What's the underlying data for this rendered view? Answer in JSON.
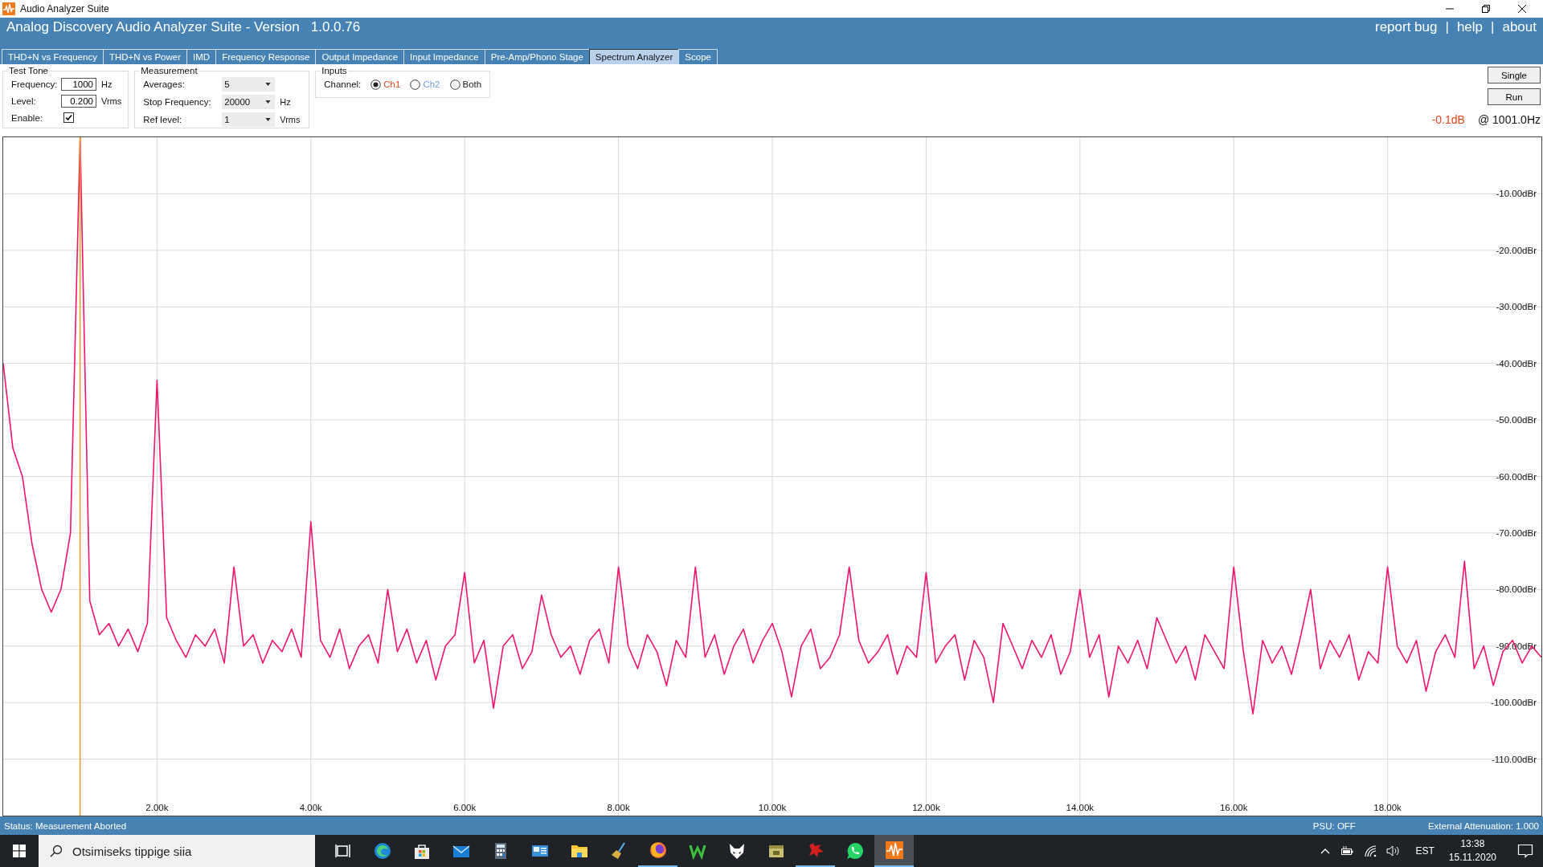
{
  "window": {
    "title": "Audio Analyzer Suite"
  },
  "header": {
    "title": "Analog Discovery Audio Analyzer Suite - Version",
    "version": "1.0.0.76",
    "links": [
      "report bug",
      "help",
      "about"
    ],
    "separator": "|"
  },
  "tabs": [
    {
      "label": "THD+N vs Frequency",
      "selected": false
    },
    {
      "label": "THD+N vs Power",
      "selected": false
    },
    {
      "label": "IMD",
      "selected": false
    },
    {
      "label": "Frequency Response",
      "selected": false
    },
    {
      "label": "Output Impedance",
      "selected": false
    },
    {
      "label": "Input Impedance",
      "selected": false
    },
    {
      "label": "Pre-Amp/Phono Stage",
      "selected": false
    },
    {
      "label": "Spectrum Analyzer",
      "selected": true
    },
    {
      "label": "Scope",
      "selected": false
    }
  ],
  "test_tone": {
    "title": "Test Tone",
    "fields": [
      {
        "label": "Frequency:",
        "value": "1000",
        "unit": "Hz"
      },
      {
        "label": "Level:",
        "value": "0.200",
        "unit": "Vrms"
      }
    ],
    "enable": {
      "label": "Enable:",
      "checked": true
    }
  },
  "measurement": {
    "title": "Measurement",
    "fields": [
      {
        "label": "Averages:",
        "value": "5"
      },
      {
        "label": "Stop Frequency:",
        "value": "20000",
        "unit": "Hz"
      },
      {
        "label": "Ref level:",
        "value": "1",
        "unit": "Vrms"
      }
    ]
  },
  "inputs": {
    "title": "Inputs",
    "channel_label": "Channel:",
    "options": [
      {
        "label": "Ch1",
        "selected": true,
        "color": "#e0441b"
      },
      {
        "label": "Ch2",
        "selected": false,
        "color": "#6b9be0"
      },
      {
        "label": "Both",
        "selected": false,
        "color": "#1a1a1a"
      }
    ]
  },
  "buttons": [
    "Single",
    "Run"
  ],
  "reading": {
    "level": "-0.1dB",
    "frequency": "@ 1001.0Hz"
  },
  "plot": {
    "chart_data": {
      "type": "line",
      "xlim": [
        0,
        20000
      ],
      "ylim": [
        -120,
        0
      ],
      "xticks": [
        {
          "value": 2000,
          "label": "2.00k"
        },
        {
          "value": 4000,
          "label": "4.00k"
        },
        {
          "value": 6000,
          "label": "6.00k"
        },
        {
          "value": 8000,
          "label": "8.00k"
        },
        {
          "value": 10000,
          "label": "10.00k"
        },
        {
          "value": 12000,
          "label": "12.00k"
        },
        {
          "value": 14000,
          "label": "14.00k"
        },
        {
          "value": 16000,
          "label": "16.00k"
        },
        {
          "value": 18000,
          "label": "18.00k"
        }
      ],
      "yticks": [
        {
          "value": -10,
          "label": "-10.00dBr"
        },
        {
          "value": -20,
          "label": "-20.00dBr"
        },
        {
          "value": -30,
          "label": "-30.00dBr"
        },
        {
          "value": -40,
          "label": "-40.00dBr"
        },
        {
          "value": -50,
          "label": "-50.00dBr"
        },
        {
          "value": -60,
          "label": "-60.00dBr"
        },
        {
          "value": -70,
          "label": "-70.00dBr"
        },
        {
          "value": -80,
          "label": "-80.00dBr"
        },
        {
          "value": -90,
          "label": "-90.00dBr"
        },
        {
          "value": -100,
          "label": "-100.00dBr"
        },
        {
          "value": -110,
          "label": "-110.00dBr"
        }
      ],
      "x": [
        0,
        125,
        250,
        375,
        500,
        625,
        750,
        875,
        1000,
        1125,
        1250,
        1375,
        1500,
        1625,
        1750,
        1875,
        2000,
        2125,
        2250,
        2375,
        2500,
        2625,
        2750,
        2875,
        3000,
        3125,
        3250,
        3375,
        3500,
        3625,
        3750,
        3875,
        4000,
        4125,
        4250,
        4375,
        4500,
        4625,
        4750,
        4875,
        5000,
        5125,
        5250,
        5375,
        5500,
        5625,
        5750,
        5875,
        6000,
        6125,
        6250,
        6375,
        6500,
        6625,
        6750,
        6875,
        7000,
        7125,
        7250,
        7375,
        7500,
        7625,
        7750,
        7875,
        8000,
        8125,
        8250,
        8375,
        8500,
        8625,
        8750,
        8875,
        9000,
        9125,
        9250,
        9375,
        9500,
        9625,
        9750,
        9875,
        10000,
        10125,
        10250,
        10375,
        10500,
        10625,
        10750,
        10875,
        11000,
        11125,
        11250,
        11375,
        11500,
        11625,
        11750,
        11875,
        12000,
        12125,
        12250,
        12375,
        12500,
        12625,
        12750,
        12875,
        13000,
        13125,
        13250,
        13375,
        13500,
        13625,
        13750,
        13875,
        14000,
        14125,
        14250,
        14375,
        14500,
        14625,
        14750,
        14875,
        15000,
        15125,
        15250,
        15375,
        15500,
        15625,
        15750,
        15875,
        16000,
        16125,
        16250,
        16375,
        16500,
        16625,
        16750,
        16875,
        17000,
        17125,
        17250,
        17375,
        17500,
        17625,
        17750,
        17875,
        18000,
        18125,
        18250,
        18375,
        18500,
        18625,
        18750,
        18875,
        19000,
        19125,
        19250,
        19375,
        19500,
        19625,
        19750,
        19875,
        20000
      ],
      "series": [
        {
          "color": "#f0146e",
          "values": [
            -40,
            -55,
            -60,
            -72,
            -80,
            -84,
            -80,
            -70,
            0,
            -82,
            -88,
            -86,
            -90,
            -87,
            -91,
            -86,
            -43,
            -85,
            -89,
            -92,
            -88,
            -90,
            -87,
            -93,
            -76,
            -90,
            -88,
            -93,
            -89,
            -91,
            -87,
            -92,
            -68,
            -89,
            -92,
            -87,
            -94,
            -90,
            -88,
            -93,
            -80,
            -91,
            -87,
            -93,
            -89,
            -96,
            -90,
            -88,
            -77,
            -93,
            -89,
            -101,
            -90,
            -88,
            -94,
            -91,
            -81,
            -88,
            -92,
            -90,
            -95,
            -89,
            -87,
            -93,
            -76,
            -90,
            -94,
            -88,
            -91,
            -97,
            -89,
            -92,
            -76,
            -92,
            -88,
            -95,
            -90,
            -87,
            -93,
            -89,
            -86,
            -91,
            -99,
            -90,
            -87,
            -94,
            -92,
            -88,
            -76,
            -89,
            -93,
            -91,
            -88,
            -95,
            -90,
            -92,
            -77,
            -93,
            -90,
            -88,
            -96,
            -89,
            -92,
            -100,
            -86,
            -90,
            -94,
            -89,
            -92,
            -88,
            -95,
            -91,
            -80,
            -92,
            -88,
            -99,
            -90,
            -93,
            -89,
            -94,
            -85,
            -89,
            -93,
            -90,
            -96,
            -88,
            -91,
            -94,
            -76,
            -91,
            -102,
            -89,
            -93,
            -90,
            -95,
            -88,
            -80,
            -94,
            -89,
            -92,
            -88,
            -96,
            -91,
            -93,
            -76,
            -90,
            -93,
            -89,
            -98,
            -91,
            -88,
            -92,
            -75,
            -94,
            -90,
            -97,
            -91,
            -89,
            -93,
            -90,
            -92
          ]
        }
      ],
      "ref_lines": [
        {
          "axis": "x",
          "value": 1000,
          "color": "#e8a317"
        }
      ],
      "grid": true
    }
  },
  "status_bar": {
    "status": "Status: Measurement Aborted",
    "psu": "PSU: OFF",
    "attenuation": "External Attenuation: 1.000"
  },
  "taskbar": {
    "search_placeholder": "Otsimiseks tippige siia",
    "apps": [
      {
        "kind": "taskview",
        "running": false,
        "active": false
      },
      {
        "kind": "edge",
        "running": false,
        "active": false
      },
      {
        "kind": "store",
        "running": false,
        "active": false
      },
      {
        "kind": "mail",
        "running": false,
        "active": false
      },
      {
        "kind": "calculator",
        "running": false,
        "active": false
      },
      {
        "kind": "monitor",
        "running": false,
        "active": false
      },
      {
        "kind": "folder",
        "running": false,
        "active": false
      },
      {
        "kind": "broom",
        "running": false,
        "active": false
      },
      {
        "kind": "firefox",
        "running": true,
        "active": false
      },
      {
        "kind": "zigzag",
        "running": false,
        "active": false
      },
      {
        "kind": "fox",
        "running": false,
        "active": false
      },
      {
        "kind": "box",
        "running": false,
        "active": false
      },
      {
        "kind": "bird",
        "running": true,
        "active": false
      },
      {
        "kind": "whatsapp",
        "running": false,
        "active": false
      },
      {
        "kind": "analyzer",
        "running": true,
        "active": true
      }
    ],
    "language": "EST",
    "time": "13:38",
    "date": "15.11.2020"
  }
}
